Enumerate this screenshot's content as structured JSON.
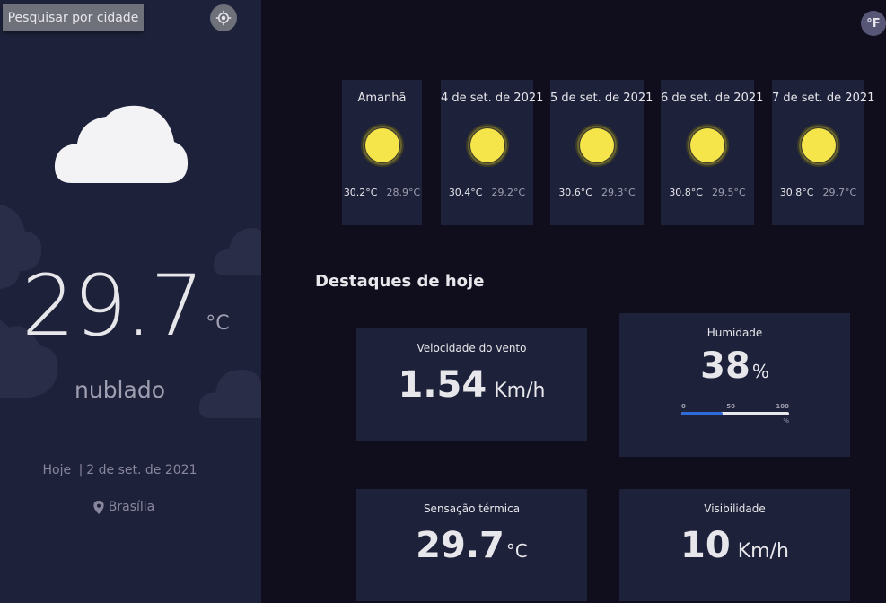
{
  "sidebar": {
    "search_label": "Pesquisar por cidade",
    "current_icon": "cloud-icon",
    "temperature": "29.7",
    "temperature_unit": "°C",
    "condition": "nublado",
    "today_label": "Hoje",
    "separator": "|",
    "date": "2 de set. de 2021",
    "location": "Brasília"
  },
  "unit_toggle": "°F",
  "forecast": [
    {
      "date": "Amanhã",
      "icon": "sun-icon",
      "max": "30.2°C",
      "min": "28.9°C"
    },
    {
      "date": "4 de set. de 2021",
      "icon": "sun-icon",
      "max": "30.4°C",
      "min": "29.2°C"
    },
    {
      "date": "5 de set. de 2021",
      "icon": "sun-icon",
      "max": "30.6°C",
      "min": "29.3°C"
    },
    {
      "date": "6 de set. de 2021",
      "icon": "sun-icon",
      "max": "30.8°C",
      "min": "29.5°C"
    },
    {
      "date": "7 de set. de 2021",
      "icon": "sun-icon",
      "max": "30.8°C",
      "min": "29.7°C"
    }
  ],
  "highlights": {
    "title": "Destaques de hoje",
    "wind": {
      "label": "Velocidade do vento",
      "value": "1.54",
      "unit": "Km/h"
    },
    "humidity": {
      "label": "Humidade",
      "value": "38",
      "unit": "%",
      "percent": 38,
      "scale_min": "0",
      "scale_mid": "50",
      "scale_max": "100",
      "scale_unit": "%"
    },
    "feels_like": {
      "label": "Sensação térmica",
      "value": "29.7",
      "unit": "°C"
    },
    "visibility": {
      "label": "Visibilidade",
      "value": "10",
      "unit": "Km/h"
    }
  },
  "colors": {
    "sidebar_bg": "#1e213a",
    "page_bg": "#100e1d",
    "card_bg": "#1e213a",
    "sun": "#f5e44a",
    "bar_fill": "#2f6bd8"
  }
}
